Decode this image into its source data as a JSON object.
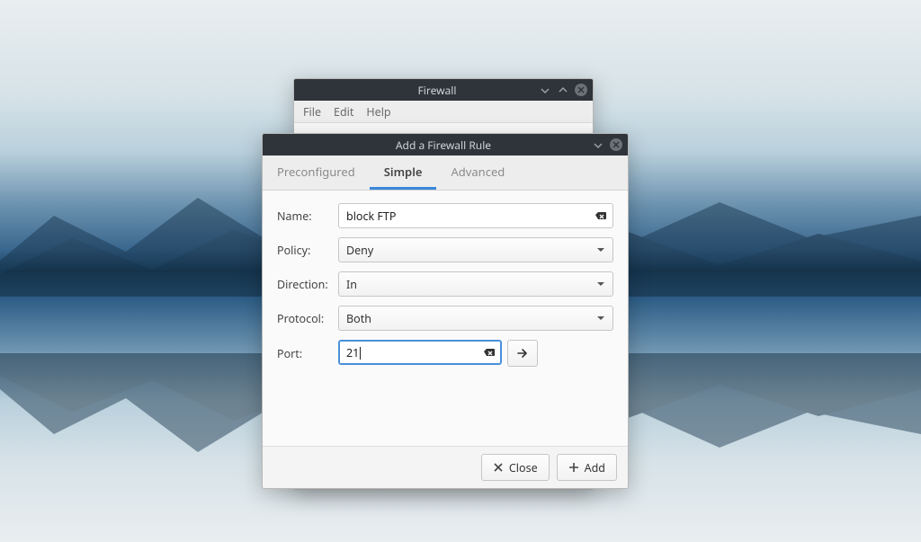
{
  "firewall_window": {
    "title": "Firewall",
    "menu": {
      "file": "File",
      "edit": "Edit",
      "help": "Help"
    }
  },
  "dialog": {
    "title": "Add a Firewall Rule",
    "tabs": {
      "preconfigured": "Preconfigured",
      "simple": "Simple",
      "advanced": "Advanced",
      "active": "simple"
    },
    "form": {
      "name": {
        "label": "Name:",
        "value": "block FTP"
      },
      "policy": {
        "label": "Policy:",
        "value": "Deny"
      },
      "direction": {
        "label": "Direction:",
        "value": "In"
      },
      "protocol": {
        "label": "Protocol:",
        "value": "Both"
      },
      "port": {
        "label": "Port:",
        "value": "21"
      }
    },
    "buttons": {
      "close": "Close",
      "add": "Add"
    }
  },
  "colors": {
    "accent": "#4a90d9",
    "titlebar": "#2f343a"
  }
}
